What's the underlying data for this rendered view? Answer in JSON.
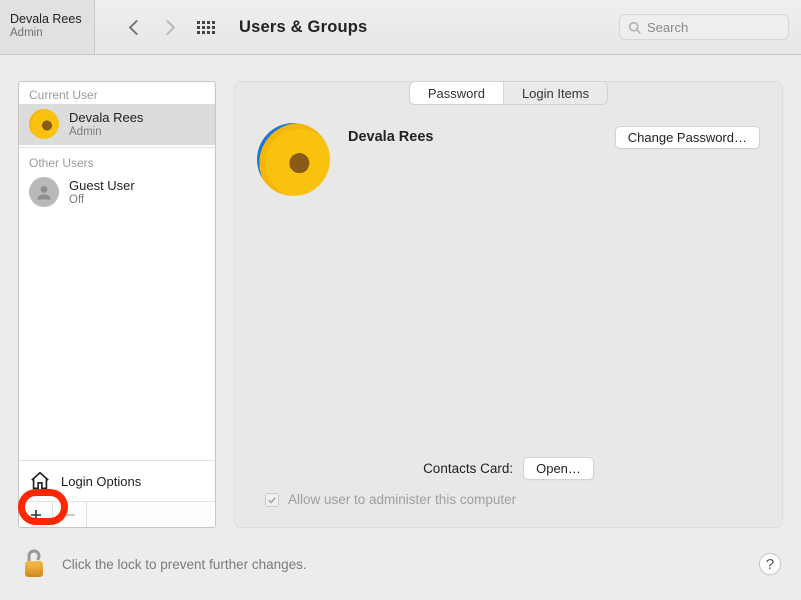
{
  "toolbar": {
    "user_name": "Devala Rees",
    "user_role": "Admin",
    "title": "Users & Groups",
    "search_placeholder": "Search"
  },
  "sidebar": {
    "current_label": "Current User",
    "other_label": "Other Users",
    "current": {
      "name": "Devala Rees",
      "role": "Admin"
    },
    "others": [
      {
        "name": "Guest User",
        "role": "Off"
      }
    ],
    "login_options": "Login Options",
    "add_label": "＋",
    "remove_label": "−"
  },
  "tabs": {
    "password": "Password",
    "login_items": "Login Items",
    "active": "password"
  },
  "detail": {
    "name": "Devala Rees",
    "change_password": "Change Password…",
    "contacts_label": "Contacts Card:",
    "open_label": "Open…",
    "admin_checkbox": "Allow user to administer this computer",
    "admin_checked": true
  },
  "footer": {
    "text": "Click the lock to prevent further changes.",
    "help": "?"
  }
}
